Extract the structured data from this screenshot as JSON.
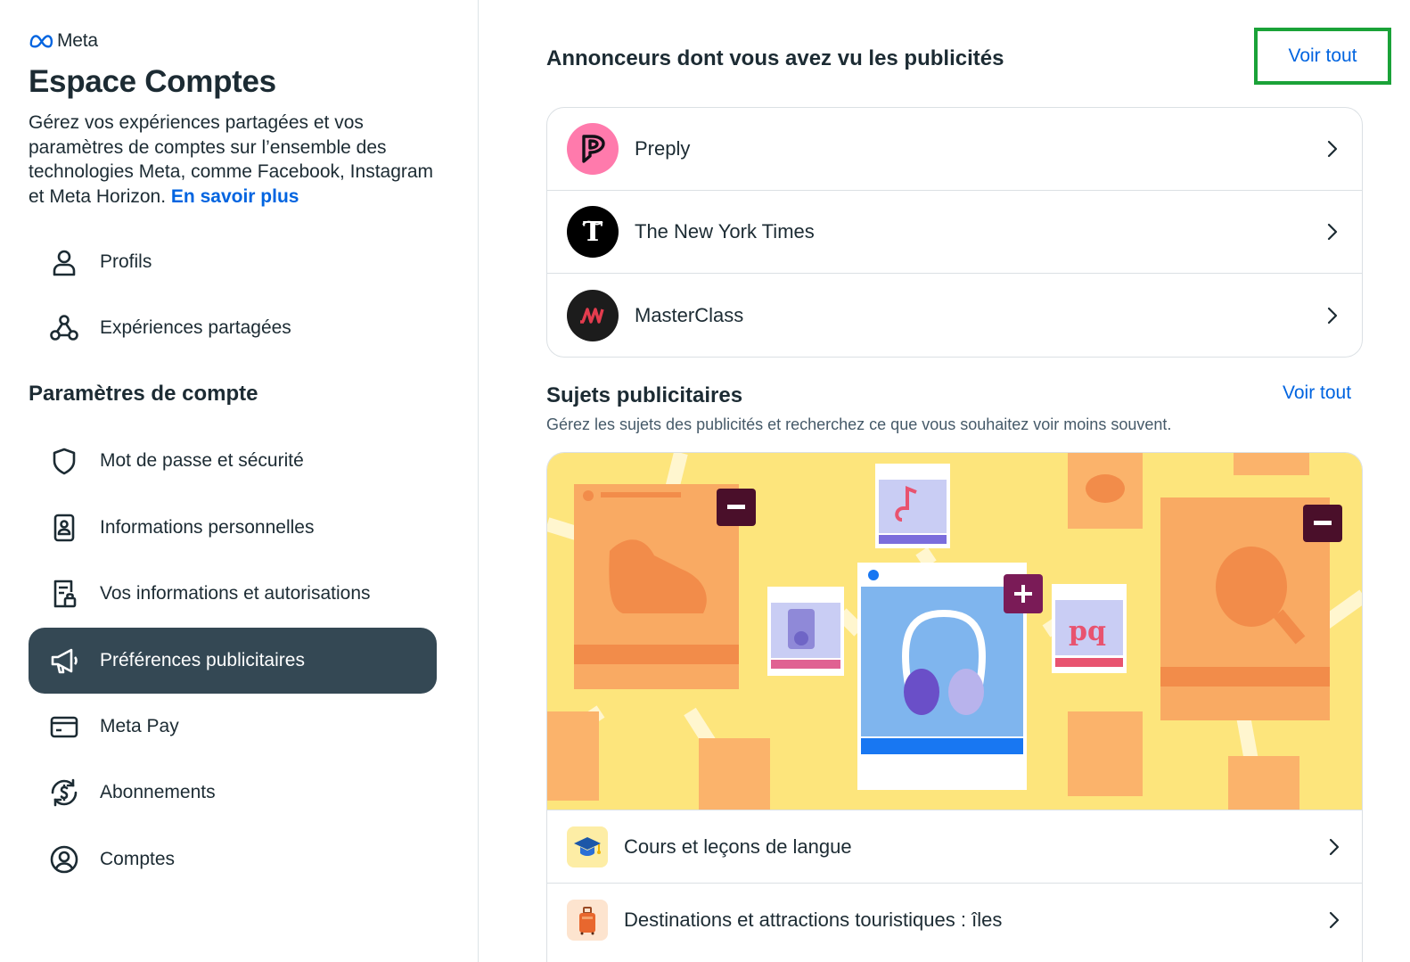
{
  "sidebar": {
    "brand": "Meta",
    "title": "Espace Comptes",
    "intro": "Gérez vos expériences partagées et vos paramètres de comptes sur l’ensemble des technologies Meta, comme Facebook, Instagram et Meta Horizon.",
    "learn_more": "En savoir plus",
    "items_top": [
      {
        "label": "Profils",
        "icon": "person-icon"
      },
      {
        "label": "Expériences partagées",
        "icon": "shared-experiences-icon"
      }
    ],
    "account_settings_title": "Paramètres de compte",
    "items_settings": [
      {
        "label": "Mot de passe et sécurité",
        "icon": "shield-icon"
      },
      {
        "label": "Informations personnelles",
        "icon": "id-card-icon"
      },
      {
        "label": "Vos informations et autorisations",
        "icon": "document-lock-icon"
      },
      {
        "label": "Préférences publicitaires",
        "icon": "megaphone-icon",
        "active": true
      },
      {
        "label": "Meta Pay",
        "icon": "credit-card-icon"
      },
      {
        "label": "Abonnements",
        "icon": "subscription-dollar-icon"
      },
      {
        "label": "Comptes",
        "icon": "account-circle-icon"
      }
    ]
  },
  "main": {
    "advertisers_title": "Annonceurs dont vous avez vu les publicités",
    "advertisers_see_all": "Voir tout",
    "advertisers": [
      {
        "name": "Preply",
        "logo": "preply-logo",
        "color": "#ff7aac"
      },
      {
        "name": "The New York Times",
        "logo": "nyt-logo",
        "color": "#000000"
      },
      {
        "name": "MasterClass",
        "logo": "masterclass-logo",
        "color": "#1c1c1c"
      }
    ],
    "topics_title": "Sujets publicitaires",
    "topics_see_all": "Voir tout",
    "topics_description": "Gérez les sujets des publicités et recherchez ce que vous souhaitez voir moins souvent.",
    "topics": [
      {
        "name": "Cours et leçons de langue",
        "icon": "graduation-cap-icon"
      },
      {
        "name": "Destinations et attractions touristiques : îles",
        "icon": "suitcase-icon"
      }
    ]
  },
  "colors": {
    "accent": "#0064e0",
    "active_nav": "#344854",
    "highlight_box": "#1aa238",
    "illustration_bg": "#fde57c"
  }
}
